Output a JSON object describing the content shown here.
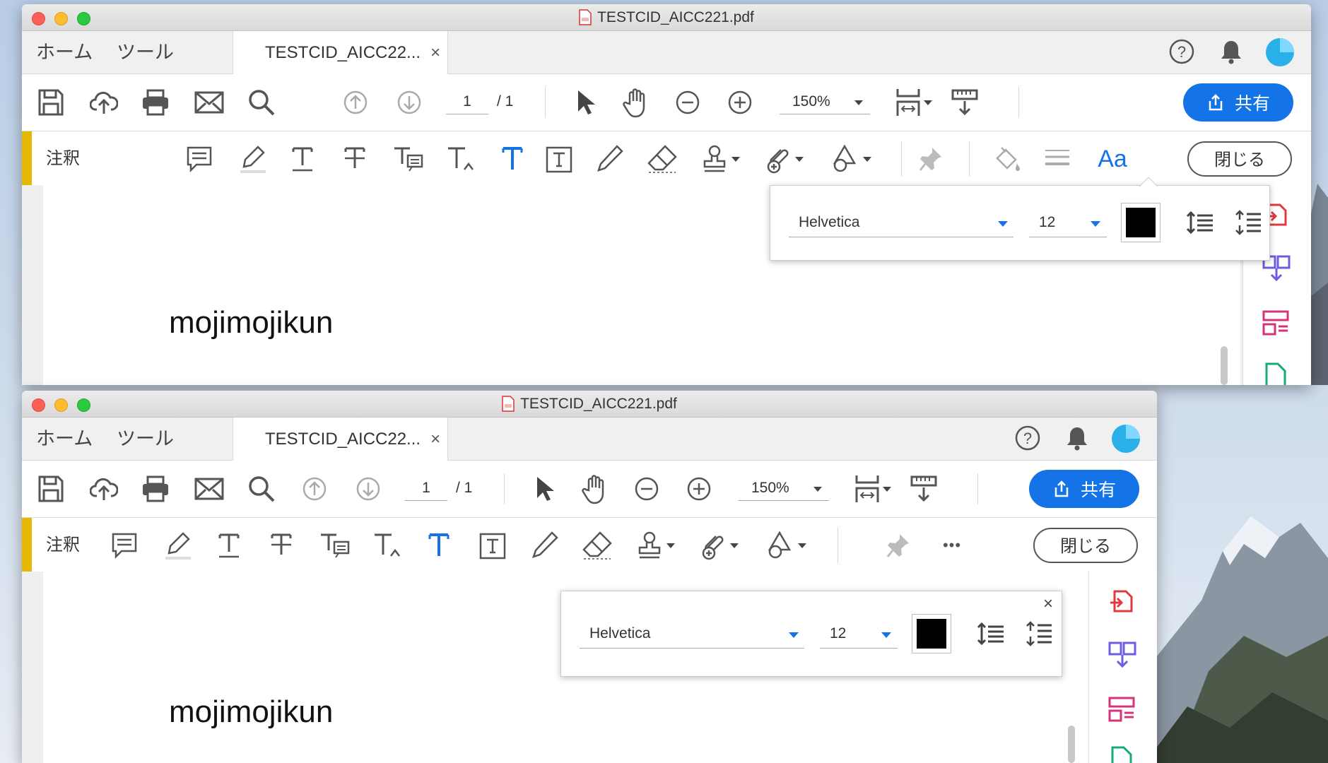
{
  "desktop": {
    "background": "mountain-wallpaper"
  },
  "window1": {
    "title": "TESTCID_AICC221.pdf",
    "tabs": {
      "home": "ホーム",
      "tools": "ツール",
      "document": "TESTCID_AICC22...",
      "close_tab": "×"
    },
    "toolbar": {
      "page_current": "1",
      "page_total": "/ 1",
      "zoom": "150%",
      "share": "共有"
    },
    "comment_bar": {
      "label": "注釈",
      "close": "閉じる",
      "text_props_label": "Aa"
    },
    "text_popup": {
      "font": "Helvetica",
      "size": "12",
      "color": "#000000"
    },
    "page_text": "mojimojikun"
  },
  "window2": {
    "title": "TESTCID_AICC221.pdf",
    "tabs": {
      "home": "ホーム",
      "tools": "ツール",
      "document": "TESTCID_AICC22...",
      "close_tab": "×"
    },
    "toolbar": {
      "page_current": "1",
      "page_total": "/ 1",
      "zoom": "150%",
      "share": "共有"
    },
    "comment_bar": {
      "label": "注釈",
      "close": "閉じる",
      "more": "•••"
    },
    "text_popup": {
      "font": "Helvetica",
      "size": "12",
      "color": "#000000",
      "close": "×"
    },
    "page_text": "mojimojikun"
  },
  "colors": {
    "accent": "#1473e6",
    "comment_bar_accent": "#e6b800"
  }
}
